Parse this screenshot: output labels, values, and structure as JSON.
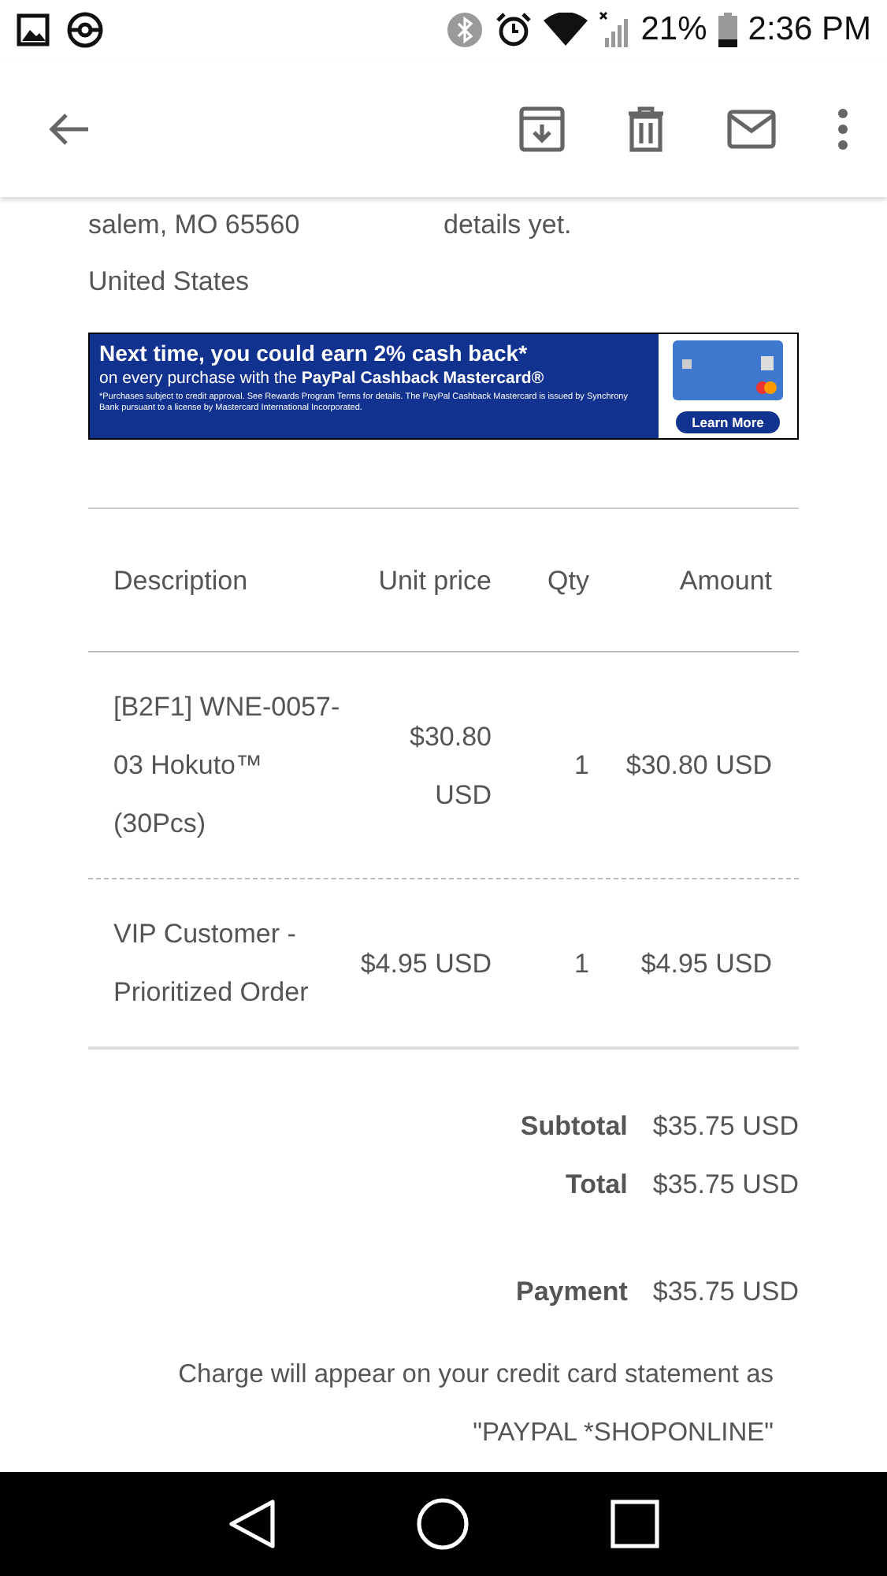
{
  "status_bar": {
    "time": "2:36 PM",
    "battery": "21%"
  },
  "address": {
    "lines": [
      "salem, MO 65560",
      "United States"
    ]
  },
  "shipping_details": {
    "lines": [
      "details yet."
    ]
  },
  "banner": {
    "headline": "Next time, you could earn 2% cash back*",
    "subline": "on every purchase with the **PayPal Cashback Mastercard®**",
    "fine_print": "*Purchases subject to credit approval. See Rewards Program Terms for details. The PayPal Cashback Mastercard is issued by Synchrony Bank pursuant to a license by Mastercard International Incorporated.",
    "button": "Learn More"
  },
  "table": {
    "columns": [
      "Description",
      "Unit price",
      "Qty",
      "Amount"
    ],
    "rows": [
      {
        "description": "[B2F1] WNE-0057-03 Hokuto™ (30Pcs)",
        "unit_price": "$30.80 USD",
        "qty": "1",
        "amount": "$30.80 USD"
      },
      {
        "description": "VIP Customer - Prioritized Order",
        "unit_price": "$4.95 USD",
        "qty": "1",
        "amount": "$4.95 USD"
      }
    ]
  },
  "totals": [
    {
      "label": "Subtotal",
      "value": "$35.75 USD"
    },
    {
      "label": "Total",
      "value": "$35.75 USD"
    }
  ],
  "payment": {
    "label": "Payment",
    "value": "$35.75 USD"
  },
  "charge_note": "Charge will appear on your credit card statement as",
  "descriptor": "\"PAYPAL *SHOPONLINE\""
}
